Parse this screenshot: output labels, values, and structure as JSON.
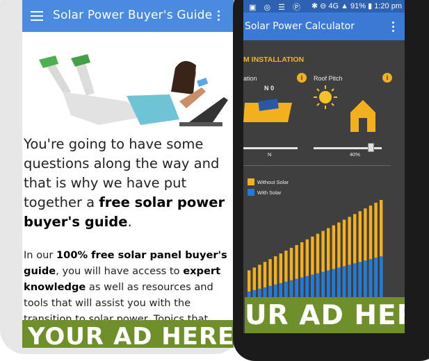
{
  "left_app": {
    "title": "Solar Power Buyer's Guide",
    "lead_text_1": "You're going to have some questions along the way and that is why we have put together a ",
    "lead_bold": "free solar power buyer's guide",
    "lead_text_2": ".",
    "para_1": "In our ",
    "para_bold_1": "100% free solar panel buyer's guide",
    "para_2": ", you will have access to ",
    "para_bold_2": "expert knowledge",
    "para_3": " as well as resources and tools that will assist you with the transition to solar power. Topics that",
    "ad_text": "YOUR AD HERE"
  },
  "right_app": {
    "status": {
      "signal": "4G",
      "battery": "91%",
      "time": "1:20 pm"
    },
    "title": "Solar Power Calculator",
    "section_heading": "M INSTALLATION",
    "orientation_label": "ation",
    "orientation_value": "N 0",
    "orientation_slider_label": "N",
    "roof_pitch_label": "Roof Pitch",
    "roof_pitch_value": "40%",
    "roof_pitch_level": 0.4,
    "legend": [
      {
        "name": "Without Solar",
        "color": "#f2b01e"
      },
      {
        "name": "With Solar",
        "color": "#1e7be0"
      }
    ],
    "ad_text": "UR AD HERE"
  },
  "chart_data": {
    "type": "bar",
    "series": [
      {
        "name": "Without Solar",
        "values": [
          38,
          42,
          46,
          50,
          54,
          58,
          62,
          66,
          70,
          74,
          78,
          82,
          86,
          90,
          94,
          98,
          102,
          106,
          110,
          114,
          118,
          122,
          126,
          130,
          134,
          138
        ]
      },
      {
        "name": "With Solar",
        "values": [
          8,
          10,
          12,
          14,
          16,
          18,
          20,
          22,
          24,
          26,
          28,
          30,
          32,
          34,
          36,
          38,
          40,
          42,
          44,
          46,
          48,
          50,
          52,
          54,
          56,
          58
        ]
      }
    ]
  },
  "colors": {
    "left_appbar": "#4a8ae0",
    "right_appbar": "#3a79d6",
    "ad_bg": "#6f8f2a",
    "accent_yellow": "#f2b01e",
    "accent_blue": "#1e7be0"
  }
}
